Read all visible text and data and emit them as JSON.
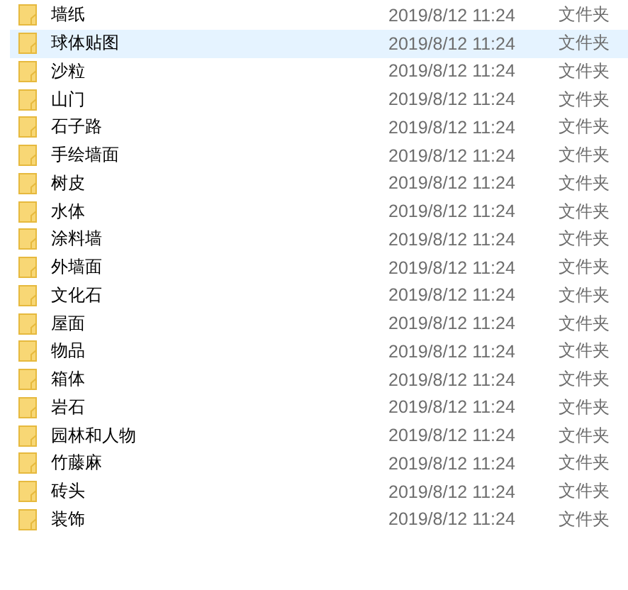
{
  "files": [
    {
      "name": "墙纸",
      "modified": "2019/8/12 11:24",
      "type": "文件夹",
      "selected": false
    },
    {
      "name": "球体贴图",
      "modified": "2019/8/12 11:24",
      "type": "文件夹",
      "selected": true
    },
    {
      "name": "沙粒",
      "modified": "2019/8/12 11:24",
      "type": "文件夹",
      "selected": false
    },
    {
      "name": "山门",
      "modified": "2019/8/12 11:24",
      "type": "文件夹",
      "selected": false
    },
    {
      "name": "石子路",
      "modified": "2019/8/12 11:24",
      "type": "文件夹",
      "selected": false
    },
    {
      "name": "手绘墙面",
      "modified": "2019/8/12 11:24",
      "type": "文件夹",
      "selected": false
    },
    {
      "name": "树皮",
      "modified": "2019/8/12 11:24",
      "type": "文件夹",
      "selected": false
    },
    {
      "name": "水体",
      "modified": "2019/8/12 11:24",
      "type": "文件夹",
      "selected": false
    },
    {
      "name": "涂料墙",
      "modified": "2019/8/12 11:24",
      "type": "文件夹",
      "selected": false
    },
    {
      "name": "外墙面",
      "modified": "2019/8/12 11:24",
      "type": "文件夹",
      "selected": false
    },
    {
      "name": "文化石",
      "modified": "2019/8/12 11:24",
      "type": "文件夹",
      "selected": false
    },
    {
      "name": "屋面",
      "modified": "2019/8/12 11:24",
      "type": "文件夹",
      "selected": false
    },
    {
      "name": "物品",
      "modified": "2019/8/12 11:24",
      "type": "文件夹",
      "selected": false
    },
    {
      "name": "箱体",
      "modified": "2019/8/12 11:24",
      "type": "文件夹",
      "selected": false
    },
    {
      "name": "岩石",
      "modified": "2019/8/12 11:24",
      "type": "文件夹",
      "selected": false
    },
    {
      "name": "园林和人物",
      "modified": "2019/8/12 11:24",
      "type": "文件夹",
      "selected": false
    },
    {
      "name": "竹藤麻",
      "modified": "2019/8/12 11:24",
      "type": "文件夹",
      "selected": false
    },
    {
      "name": "砖头",
      "modified": "2019/8/12 11:24",
      "type": "文件夹",
      "selected": false
    },
    {
      "name": "装饰",
      "modified": "2019/8/12 11:24",
      "type": "文件夹",
      "selected": false
    }
  ]
}
